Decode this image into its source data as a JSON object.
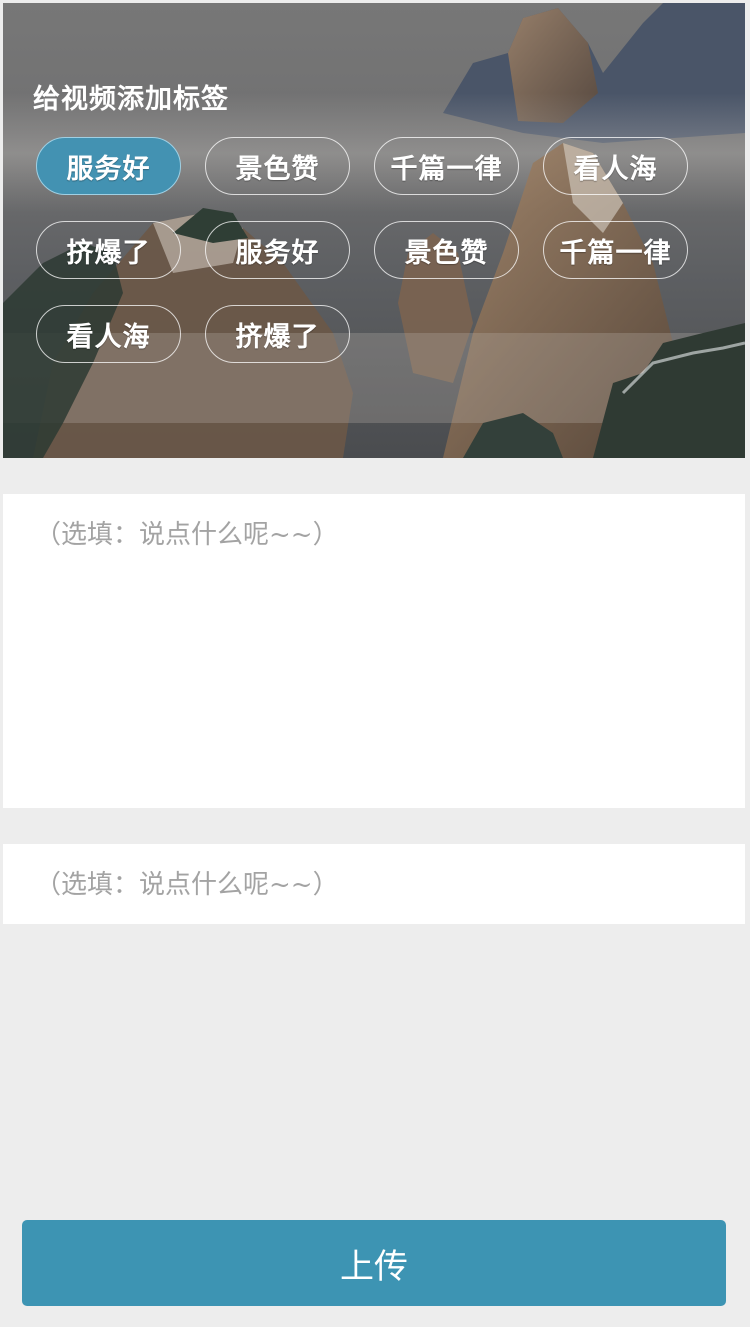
{
  "header": {
    "title": "给视频添加标签"
  },
  "tags": [
    {
      "label": "服务好",
      "selected": true
    },
    {
      "label": "景色赞",
      "selected": false
    },
    {
      "label": "千篇一律",
      "selected": false
    },
    {
      "label": "看人海",
      "selected": false
    },
    {
      "label": "挤爆了",
      "selected": false
    },
    {
      "label": "服务好",
      "selected": false
    },
    {
      "label": "景色赞",
      "selected": false
    },
    {
      "label": "千篇一律",
      "selected": false
    },
    {
      "label": "看人海",
      "selected": false
    },
    {
      "label": "挤爆了",
      "selected": false
    }
  ],
  "comment": {
    "placeholder": "（选填：说点什么呢~~）",
    "value": ""
  },
  "short_input": {
    "placeholder": "（选填：说点什么呢~~）",
    "value": ""
  },
  "upload_button": {
    "label": "上传"
  },
  "colors": {
    "accent": "#3d94b3",
    "selected_tag": "#4392b2",
    "page_background": "#ededed"
  }
}
